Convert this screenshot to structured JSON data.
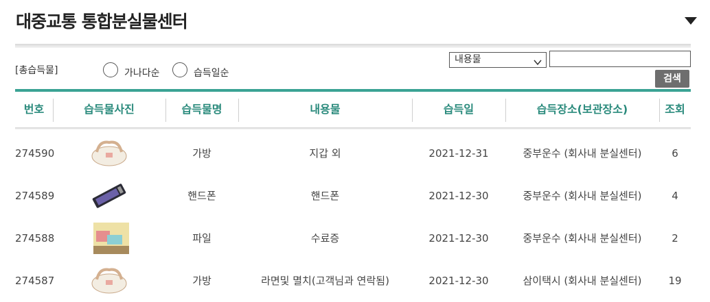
{
  "header": {
    "title": "대중교통 통합분실물센터",
    "menu_icon": "triangle-down-icon"
  },
  "filter": {
    "sort_label": "[총습득물]",
    "sort_options": [
      "가나다순",
      "습득일순"
    ],
    "category_select": "내용물",
    "search_value": "",
    "search_button": "검색"
  },
  "table": {
    "columns": [
      "번호",
      "습득물사진",
      "습득물명",
      "내용물",
      "습득일",
      "습득장소(보관장소)",
      "조회"
    ],
    "rows": [
      {
        "id": "274590",
        "photo": "bag-photo",
        "name": "가방",
        "contents": "지갑 외",
        "date": "2021-12-31",
        "place": "중부운수 (회사내 분실센터)",
        "views": "6"
      },
      {
        "id": "274589",
        "photo": "phone-photo",
        "name": "핸드폰",
        "contents": "핸드폰",
        "date": "2021-12-30",
        "place": "중부운수 (회사내 분실센터)",
        "views": "4"
      },
      {
        "id": "274588",
        "photo": "file-photo",
        "name": "파일",
        "contents": "수료증",
        "date": "2021-12-30",
        "place": "중부운수 (회사내 분실센터)",
        "views": "2"
      },
      {
        "id": "274587",
        "photo": "bag-photo",
        "name": "가방",
        "contents": "라면및 멸치(고객님과 연락됨)",
        "date": "2021-12-30",
        "place": "삼이택시 (회사내 분실센터)",
        "views": "19"
      }
    ]
  },
  "colors": {
    "accent": "#3aa394",
    "header_text": "#2a8a7c",
    "button": "#6e6e6e"
  }
}
